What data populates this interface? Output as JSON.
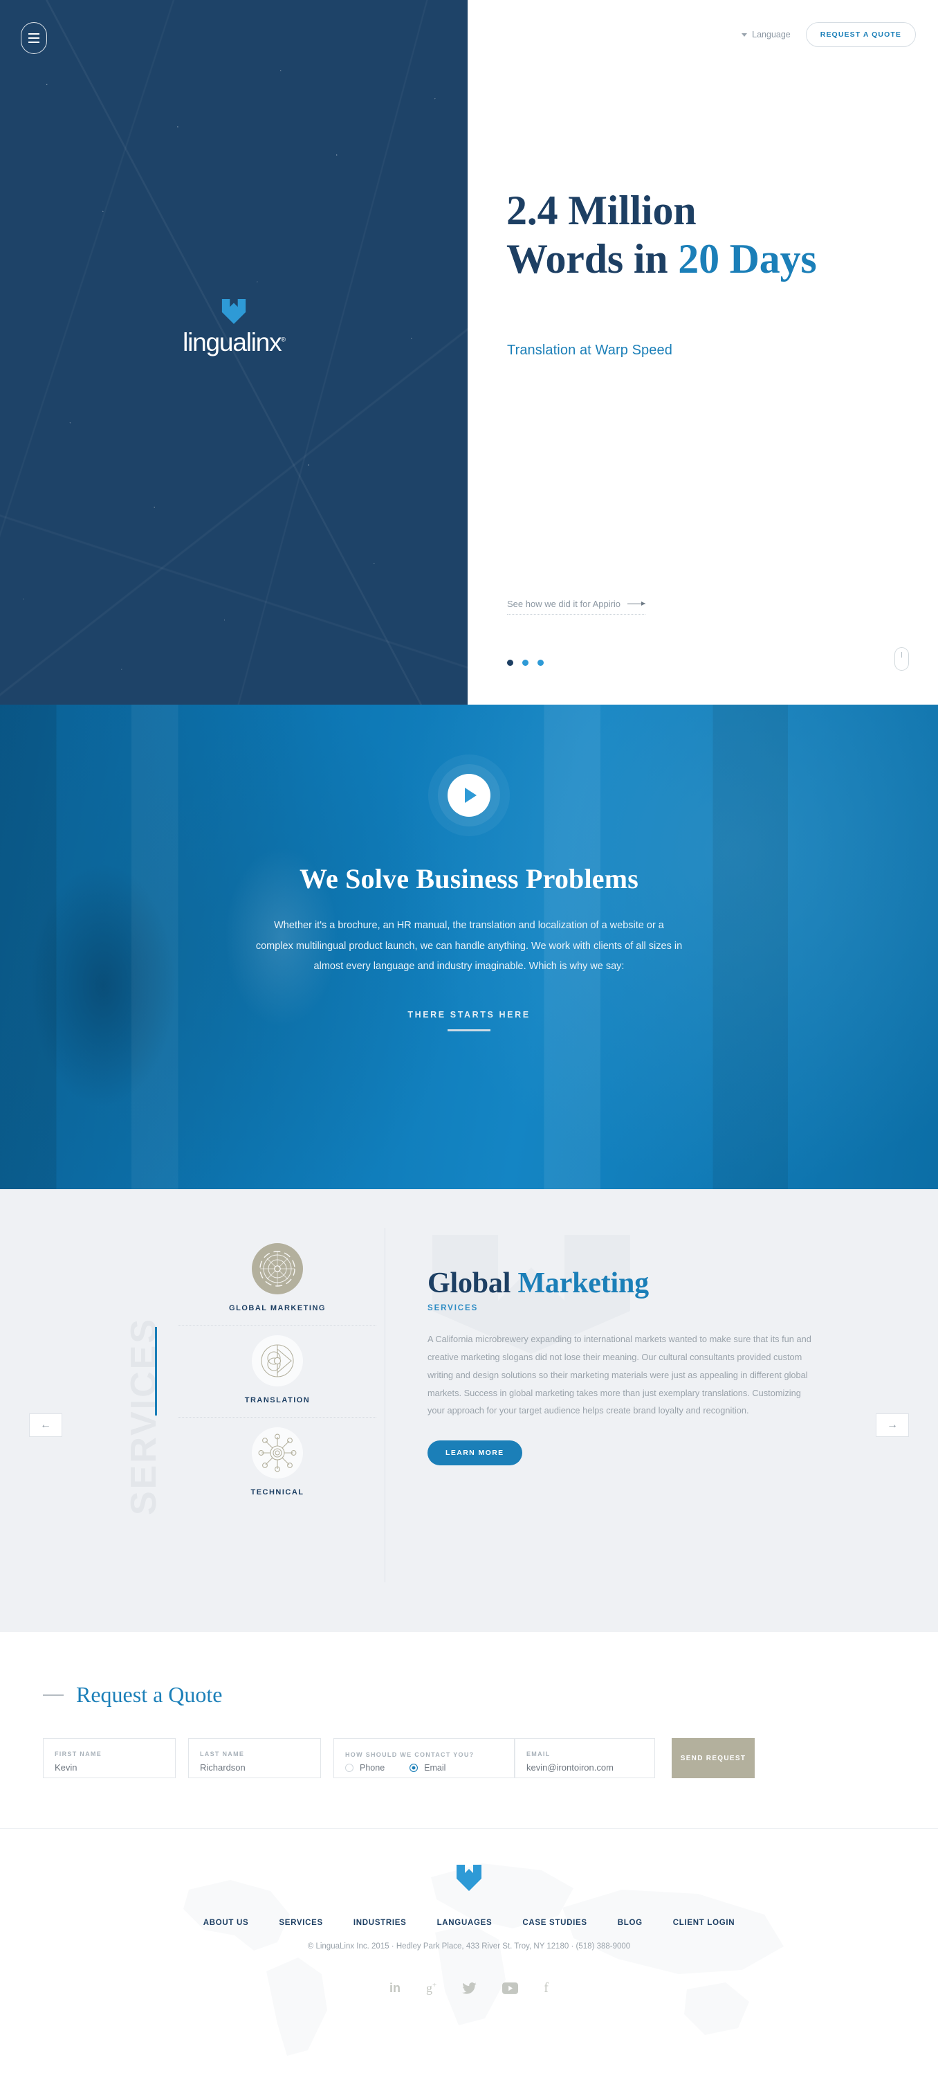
{
  "brand": {
    "name": "lingualinx",
    "registered": "®",
    "accent_blue": "#1b7fb8",
    "navy": "#1d3f63",
    "tan": "#b3b09d"
  },
  "header": {
    "menu_icon": "hamburger-icon",
    "language_label": "Language",
    "quote_button": "REQUEST A QUOTE"
  },
  "hero": {
    "headline_line1_dark": "2.4 Million",
    "headline_line2_dark": "Words in ",
    "headline_line2_accent": "20 Days",
    "subtitle": "Translation at Warp Speed",
    "case_link": "See how we did it for Appirio",
    "carousel_dots": 3,
    "active_dot": 1,
    "scroll_indicator": "scroll-down-icon"
  },
  "video_section": {
    "play_icon": "play-icon",
    "title": "We Solve Business Problems",
    "body": "Whether it's a brochure, an HR manual, the translation and localization of a website or a complex multilingual product launch, we can handle anything. We work with clients of all sizes in almost every language and industry imaginable. Which is why we say:",
    "cta": "THERE STARTS HERE"
  },
  "services": {
    "vertical_label": "SERVICES",
    "prev_arrow": "←",
    "next_arrow": "→",
    "tabs": [
      {
        "label": "GLOBAL MARKETING",
        "icon": "compass-icon",
        "active": true
      },
      {
        "label": "TRANSLATION",
        "icon": "globe-translate-icon",
        "active": false
      },
      {
        "label": "TECHNICAL",
        "icon": "network-hub-icon",
        "active": false
      }
    ],
    "panel": {
      "title_dark": "Global ",
      "title_accent": "Marketing",
      "subtitle": "SERVICES",
      "body": "A California microbrewery expanding to international markets wanted to make sure that its fun and creative marketing slogans did not lose their meaning. Our cultural consultants provided custom writing and design solutions so their marketing materials were just as appealing in different global markets. Success in global marketing takes more than just exemplary translations. Customizing your approach for your target audience helps create brand loyalty and recognition.",
      "button": "LEARN MORE"
    }
  },
  "quote_form": {
    "heading": "Request a Quote",
    "fields": {
      "first_name_label": "FIRST NAME",
      "first_name_value": "Kevin",
      "last_name_label": "LAST NAME",
      "last_name_value": "Richardson",
      "contact_label": "HOW SHOULD WE CONTACT YOU?",
      "contact_option_phone": "Phone",
      "contact_option_email": "Email",
      "contact_selected": "Email",
      "email_label": "EMAIL",
      "email_value": "kevin@irontoiron.com"
    },
    "submit": "SEND REQUEST"
  },
  "footer": {
    "logo_icon": "lingualinx-shield-icon",
    "nav": [
      "ABOUT US",
      "SERVICES",
      "INDUSTRIES",
      "LANGUAGES",
      "CASE STUDIES",
      "BLOG",
      "CLIENT LOGIN"
    ],
    "copyright": "© LinguaLinx Inc. 2015  ·  Hedley Park Place, 433 River St. Troy, NY 12180  ·  (518) 388-9000",
    "socials": [
      {
        "name": "linkedin-icon",
        "glyph": "in"
      },
      {
        "name": "googleplus-icon",
        "glyph": "g+"
      },
      {
        "name": "twitter-icon",
        "glyph": "t"
      },
      {
        "name": "youtube-icon",
        "glyph": "yt"
      },
      {
        "name": "facebook-icon",
        "glyph": "f"
      }
    ]
  }
}
